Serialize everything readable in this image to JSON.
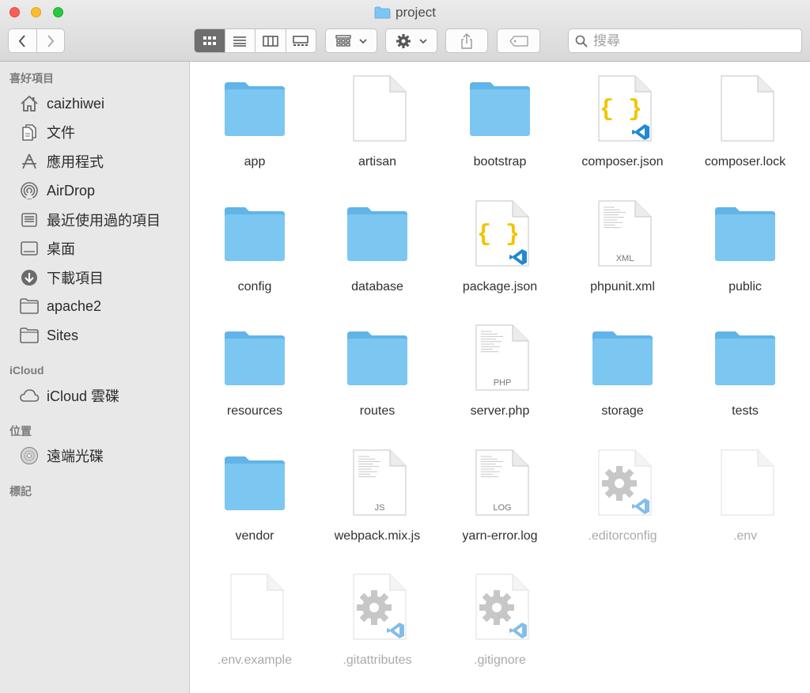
{
  "window": {
    "title": "project"
  },
  "search": {
    "placeholder": "搜尋"
  },
  "sidebar": {
    "favorites_header": "喜好項目",
    "favorites": [
      {
        "label": "caizhiwei",
        "icon": "home-icon"
      },
      {
        "label": "文件",
        "icon": "document-icon"
      },
      {
        "label": "應用程式",
        "icon": "applications-icon"
      },
      {
        "label": "AirDrop",
        "icon": "airdrop-icon"
      },
      {
        "label": "最近使用過的項目",
        "icon": "recents-icon"
      },
      {
        "label": "桌面",
        "icon": "desktop-icon"
      },
      {
        "label": "下載項目",
        "icon": "downloads-icon"
      },
      {
        "label": "apache2",
        "icon": "folder-icon"
      },
      {
        "label": "Sites",
        "icon": "folder-icon"
      }
    ],
    "icloud_header": "iCloud",
    "icloud": [
      {
        "label": "iCloud 雲碟",
        "icon": "cloud-icon"
      }
    ],
    "locations_header": "位置",
    "locations": [
      {
        "label": "遠端光碟",
        "icon": "disc-icon"
      }
    ],
    "tags_header": "標記"
  },
  "files": [
    {
      "name": "app",
      "kind": "folder"
    },
    {
      "name": "artisan",
      "kind": "blank"
    },
    {
      "name": "bootstrap",
      "kind": "folder"
    },
    {
      "name": "composer.json",
      "kind": "json"
    },
    {
      "name": "composer.lock",
      "kind": "blank"
    },
    {
      "name": "config",
      "kind": "folder"
    },
    {
      "name": "database",
      "kind": "folder"
    },
    {
      "name": "package.json",
      "kind": "json"
    },
    {
      "name": "phpunit.xml",
      "kind": "text",
      "ext": "XML"
    },
    {
      "name": "public",
      "kind": "folder"
    },
    {
      "name": "resources",
      "kind": "folder"
    },
    {
      "name": "routes",
      "kind": "folder"
    },
    {
      "name": "server.php",
      "kind": "text",
      "ext": "PHP"
    },
    {
      "name": "storage",
      "kind": "folder"
    },
    {
      "name": "tests",
      "kind": "folder"
    },
    {
      "name": "vendor",
      "kind": "folder"
    },
    {
      "name": "webpack.mix.js",
      "kind": "text",
      "ext": "JS"
    },
    {
      "name": "yarn-error.log",
      "kind": "text",
      "ext": "LOG"
    },
    {
      "name": ".editorconfig",
      "kind": "gear",
      "hidden": true
    },
    {
      "name": ".env",
      "kind": "blank",
      "hidden": true
    },
    {
      "name": ".env.example",
      "kind": "blank",
      "hidden": true
    },
    {
      "name": ".gitattributes",
      "kind": "gear",
      "hidden": true
    },
    {
      "name": ".gitignore",
      "kind": "gear",
      "hidden": true
    }
  ],
  "colors": {
    "folder": "#7cc6f2",
    "folder_tab": "#61b4e8",
    "vscode_blue": "#1f8ad2",
    "json_brace": "#f1c400"
  }
}
